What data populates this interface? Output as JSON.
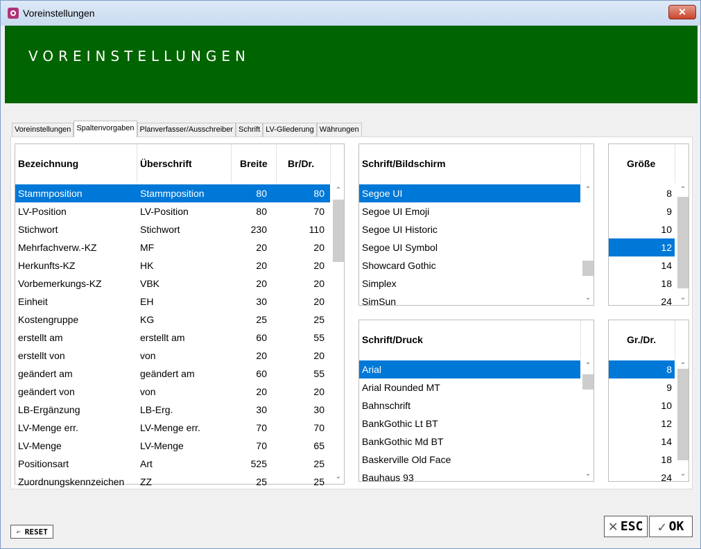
{
  "window": {
    "title": "Voreinstellungen",
    "close_label": "✕",
    "banner_title": "VOREINSTELLUNGEN"
  },
  "tabs": [
    {
      "label": "Voreinstellungen",
      "active": false
    },
    {
      "label": "Spaltenvorgaben",
      "active": true
    },
    {
      "label": "Planverfasser/Ausschreiber",
      "active": false
    },
    {
      "label": "Schrift",
      "active": false
    },
    {
      "label": "LV-Gliederung",
      "active": false
    },
    {
      "label": "Währungen",
      "active": false
    }
  ],
  "columns_table": {
    "headers": {
      "bezeichnung": "Bezeichnung",
      "ueberschrift": "Überschrift",
      "breite": "Breite",
      "brdr": "Br/Dr."
    },
    "rows": [
      {
        "bezeichnung": "Stammposition",
        "ueberschrift": "Stammposition",
        "breite": "80",
        "brdr": "80",
        "selected": true
      },
      {
        "bezeichnung": "LV-Position",
        "ueberschrift": "LV-Position",
        "breite": "80",
        "brdr": "70"
      },
      {
        "bezeichnung": "Stichwort",
        "ueberschrift": "Stichwort",
        "breite": "230",
        "brdr": "110"
      },
      {
        "bezeichnung": "Mehrfachverw.-KZ",
        "ueberschrift": "MF",
        "breite": "20",
        "brdr": "20"
      },
      {
        "bezeichnung": "Herkunfts-KZ",
        "ueberschrift": "HK",
        "breite": "20",
        "brdr": "20"
      },
      {
        "bezeichnung": "Vorbemerkungs-KZ",
        "ueberschrift": "VBK",
        "breite": "20",
        "brdr": "20"
      },
      {
        "bezeichnung": "Einheit",
        "ueberschrift": "EH",
        "breite": "30",
        "brdr": "20"
      },
      {
        "bezeichnung": "Kostengruppe",
        "ueberschrift": "KG",
        "breite": "25",
        "brdr": "25"
      },
      {
        "bezeichnung": "erstellt am",
        "ueberschrift": "erstellt am",
        "breite": "60",
        "brdr": "55"
      },
      {
        "bezeichnung": "erstellt von",
        "ueberschrift": "von",
        "breite": "20",
        "brdr": "20"
      },
      {
        "bezeichnung": "geändert am",
        "ueberschrift": "geändert am",
        "breite": "60",
        "brdr": "55"
      },
      {
        "bezeichnung": "geändert von",
        "ueberschrift": "von",
        "breite": "20",
        "brdr": "20"
      },
      {
        "bezeichnung": "LB-Ergänzung",
        "ueberschrift": "LB-Erg.",
        "breite": "30",
        "brdr": "30"
      },
      {
        "bezeichnung": "LV-Menge err.",
        "ueberschrift": "LV-Menge err.",
        "breite": "70",
        "brdr": "70"
      },
      {
        "bezeichnung": "LV-Menge",
        "ueberschrift": "LV-Menge",
        "breite": "70",
        "brdr": "65"
      },
      {
        "bezeichnung": "Positionsart",
        "ueberschrift": "Art",
        "breite": "525",
        "brdr": "25"
      },
      {
        "bezeichnung": "Zuordnungskennzeichen",
        "ueberschrift": "ZZ",
        "breite": "25",
        "brdr": "25"
      }
    ]
  },
  "font_screen": {
    "header": "Schrift/Bildschirm",
    "items": [
      {
        "label": "Segoe UI",
        "selected": true
      },
      {
        "label": "Segoe UI Emoji"
      },
      {
        "label": "Segoe UI Historic"
      },
      {
        "label": "Segoe UI Symbol"
      },
      {
        "label": "Showcard Gothic"
      },
      {
        "label": "Simplex"
      },
      {
        "label": "SimSun"
      }
    ]
  },
  "size_screen": {
    "header": "Größe",
    "items": [
      {
        "label": "8"
      },
      {
        "label": "9"
      },
      {
        "label": "10"
      },
      {
        "label": "12",
        "selected": true
      },
      {
        "label": "14"
      },
      {
        "label": "18"
      },
      {
        "label": "24"
      }
    ]
  },
  "font_print": {
    "header": "Schrift/Druck",
    "items": [
      {
        "label": "Arial",
        "selected": true
      },
      {
        "label": "Arial Rounded MT"
      },
      {
        "label": "Bahnschrift"
      },
      {
        "label": "BankGothic Lt BT"
      },
      {
        "label": "BankGothic Md BT"
      },
      {
        "label": "Baskerville Old Face"
      },
      {
        "label": "Bauhaus 93"
      }
    ]
  },
  "size_print": {
    "header": "Gr./Dr.",
    "items": [
      {
        "label": "8",
        "selected": true
      },
      {
        "label": "9"
      },
      {
        "label": "10"
      },
      {
        "label": "12"
      },
      {
        "label": "14"
      },
      {
        "label": "18"
      },
      {
        "label": "24"
      }
    ]
  },
  "buttons": {
    "reset": "RESET",
    "esc": "ESC",
    "ok": "OK"
  },
  "colors": {
    "banner": "#006400",
    "selection": "#0078d7"
  }
}
